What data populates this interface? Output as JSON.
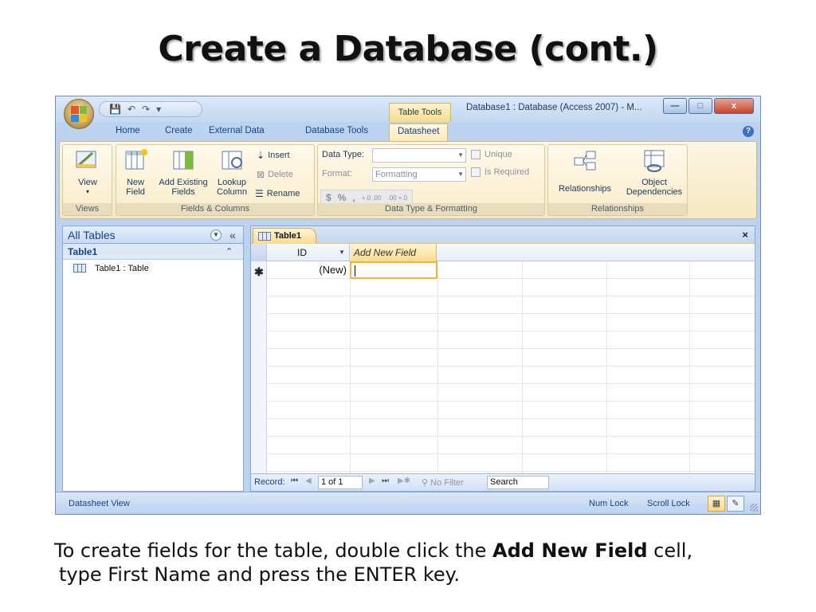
{
  "slide": {
    "title": "Create a Database (cont.)",
    "caption_before": "To create fields for the table, double click the",
    "caption_bold": "Add New Field",
    "caption_after": "cell,",
    "caption_line2": "type First Name and press the ENTER key."
  },
  "window": {
    "title": "Database1 : Database (Access 2007) - M...",
    "context_tab": "Table Tools",
    "close_label": "x"
  },
  "ribbon_tabs": [
    "Home",
    "Create",
    "External Data",
    "Database Tools",
    "Datasheet"
  ],
  "active_tab": "Datasheet",
  "ribbon": {
    "views": {
      "label": "Views",
      "view_button": "View"
    },
    "fields_columns": {
      "label": "Fields & Columns",
      "new_field": [
        "New",
        "Field"
      ],
      "add_existing": [
        "Add Existing",
        "Fields"
      ],
      "lookup": [
        "Lookup",
        "Column"
      ],
      "insert": "Insert",
      "delete": "Delete",
      "rename": "Rename"
    },
    "data_type": {
      "label": "Data Type & Formatting",
      "data_type_label": "Data Type:",
      "data_type_value": "",
      "format_label": "Format:",
      "format_value": "Formatting",
      "unique": "Unique",
      "is_required": "Is Required",
      "fmt_buttons": [
        "$",
        "%",
        ",",
        "+.0 .00",
        ".00 +.0"
      ]
    },
    "relationships": {
      "label": "Relationships",
      "relationships_button": "Relationships",
      "object_dependencies": [
        "Object",
        "Dependencies"
      ]
    }
  },
  "nav_pane": {
    "header": "All Tables",
    "group": "Table1",
    "items": [
      "Table1 : Table"
    ]
  },
  "document": {
    "tab": "Table1",
    "columns": [
      "ID",
      "Add New Field"
    ],
    "new_row_id": "(New)",
    "record_label": "Record:",
    "record_position": "1 of 1",
    "no_filter": "No Filter",
    "search": "Search"
  },
  "status": {
    "left": "Datasheet View",
    "num_lock": "Num Lock",
    "scroll_lock": "Scroll Lock"
  },
  "colors": {
    "accent": "#15428b",
    "highlight": "#f2b33a",
    "ribbon_bg": "#f6e8c2"
  }
}
